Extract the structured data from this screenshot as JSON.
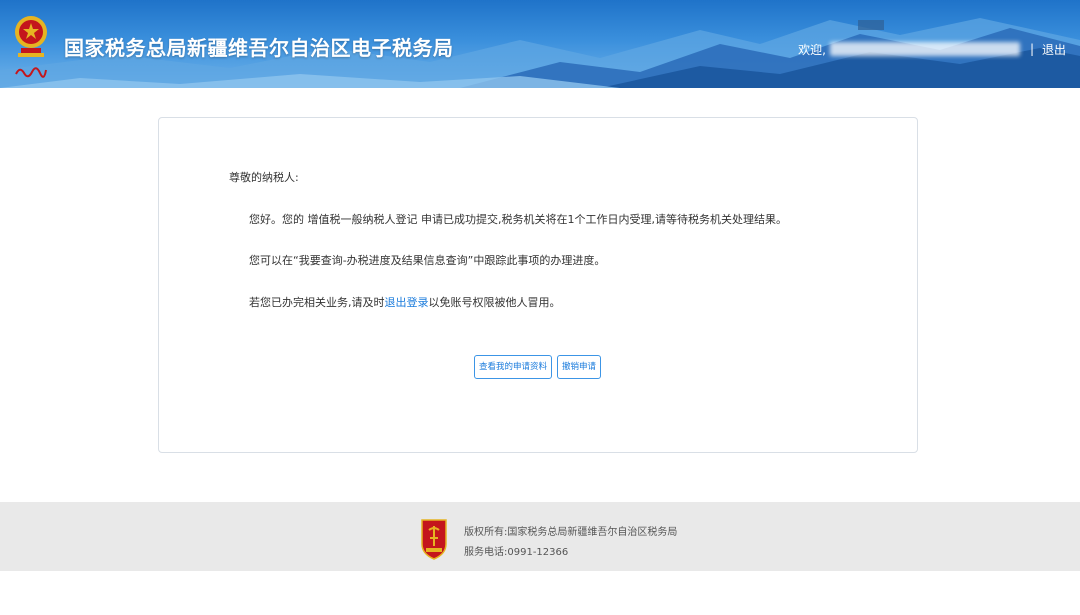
{
  "header": {
    "site_title": "国家税务总局新疆维吾尔自治区电子税务局",
    "welcome_label": "欢迎,",
    "separator": "|",
    "logout_label": "退出",
    "brand_colors": {
      "header_blue": "#1f73c9",
      "emblem_red": "#c4161c",
      "emblem_gold": "#e6b422"
    }
  },
  "message": {
    "greeting": "尊敬的纳税人:",
    "line1": "您好。您的 增值税一般纳税人登记 申请已成功提交,税务机关将在1个工作日内受理,请等待税务机关处理结果。",
    "line2": "您可以在“我要查询-办税进度及结果信息查询”中跟踪此事项的办理进度。",
    "line3_before": "若您已办完相关业务,请及时",
    "line3_link": "退出登录",
    "line3_after": "以免账号权限被他人冒用。"
  },
  "actions": {
    "view_application": "查看我的申请资料",
    "cancel_application": "撤销申请"
  },
  "footer": {
    "copyright": "版权所有:国家税务总局新疆维吾尔自治区税务局",
    "phone": "服务电话:0991-12366"
  },
  "colors": {
    "link": "#1a7bdc",
    "footer_bg": "#e9e9e9",
    "card_border": "#d9dfe6"
  }
}
